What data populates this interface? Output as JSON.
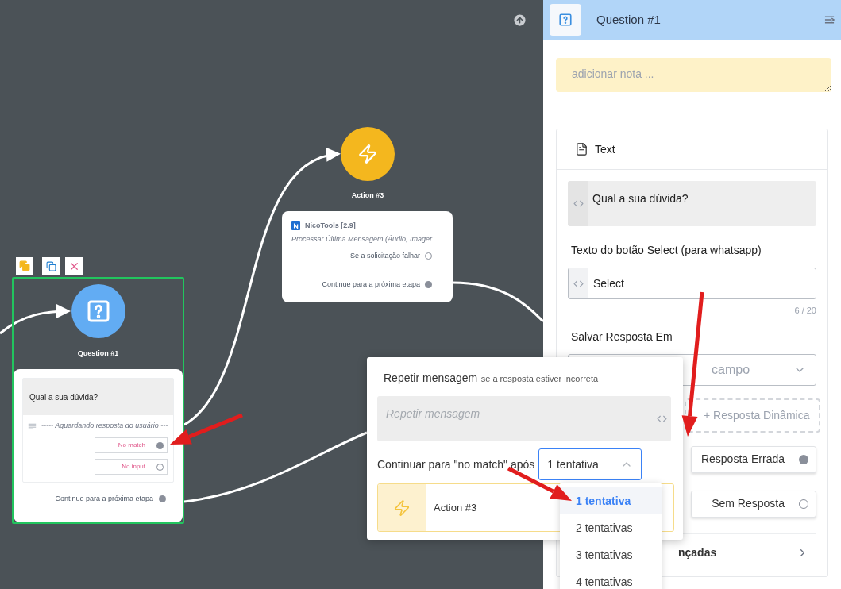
{
  "canvas": {
    "action_node": {
      "title": "Action #3",
      "plugin": "NicoTools [2.9]",
      "description": "Processar Última Mensagem (Áudio, Imager",
      "ports": [
        {
          "label": "Se a solicitação falhar",
          "connected": false
        },
        {
          "label": "Continue para a próxima etapa",
          "connected": true
        }
      ]
    },
    "question_node": {
      "title": "Question #1",
      "selected": true,
      "message": "Qual a sua dúvida?",
      "waiting": "----- Aguardando resposta do usuário ---",
      "ports": [
        {
          "label": "No match",
          "connected": true
        },
        {
          "label": "No input",
          "connected": false
        }
      ],
      "next": {
        "label": "Continue para a próxima etapa",
        "connected": true
      }
    }
  },
  "panel": {
    "title": "Question #1",
    "note_placeholder": "adicionar nota ...",
    "section": "Text",
    "message": "Qual a sua dúvida?",
    "button_label": "Texto do botão Select (para whatsapp)",
    "button_value": "Select",
    "counter": "6 / 20",
    "save_label": "Salvar Resposta Em",
    "save_placeholder": "campo",
    "dynamic": "+ Resposta Dinâmica",
    "outcomes": [
      {
        "label": "Resposta Errada",
        "connected": true
      },
      {
        "label": "Sem Resposta",
        "connected": false
      }
    ],
    "advanced": "nçadas"
  },
  "popover": {
    "title": "Repetir mensagem",
    "hint": "se a resposta estiver incorreta",
    "placeholder": "Repetir mensagem",
    "continue_label": "Continuar para \"no match\" após",
    "value": "1 tentativa",
    "expanded": true,
    "target": "Action #3",
    "options": [
      {
        "label": "1 tentativa",
        "selected": true
      },
      {
        "label": "2 tentativas",
        "selected": false
      },
      {
        "label": "3 tentativas",
        "selected": false
      },
      {
        "label": "4 tentativas",
        "selected": false
      }
    ]
  }
}
